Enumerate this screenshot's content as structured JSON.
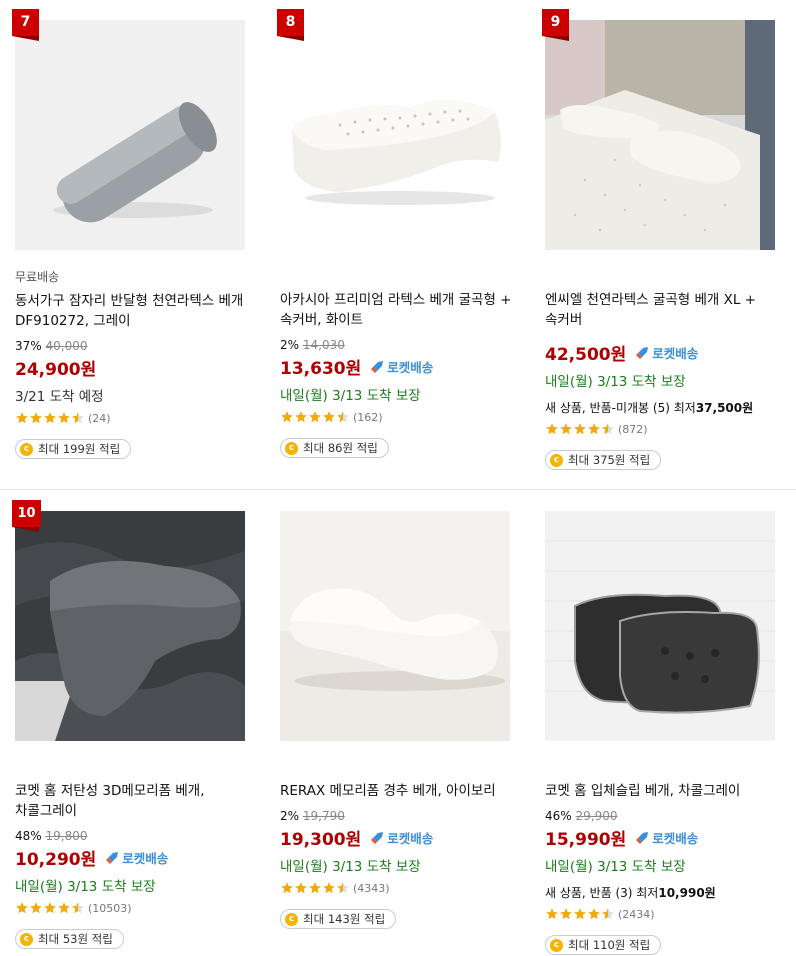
{
  "products": [
    {
      "rank": "7",
      "free_shipping": "무료배송",
      "title": "동서가구 잠자리 반달형 천연라텍스 베개 DF910272, 그레이",
      "discount_rate": "37%",
      "original_price": "40,000",
      "price": "24,900원",
      "delivery": "3/21 도착 예정",
      "rating": 4.5,
      "review_count": "(24)",
      "reward": "최대 199원 적립",
      "image": "gray-half-moon-pillow"
    },
    {
      "rank": "8",
      "title": "아카시아 프리미엄 라텍스 베개 굴곡형 + 속커버, 화이트",
      "discount_rate": "2%",
      "original_price": "14,030",
      "price": "13,630원",
      "rocket_label": "로켓배송",
      "delivery": "내일(월) 3/13 도착 보장",
      "rating": 4.5,
      "review_count": "(162)",
      "reward": "최대 86원 적립",
      "image": "white-latex-contour-pillow"
    },
    {
      "rank": "9",
      "title": "엔씨엘 천연라텍스 굴곡형 베개 XL + 속커버",
      "price": "42,500원",
      "rocket_label": "로켓배송",
      "delivery": "내일(월) 3/13 도착 보장",
      "extra_text": "새 상품, 반품-미개봉 (5) 최저",
      "extra_price": "37,500원",
      "rating": 4.5,
      "review_count": "(872)",
      "reward": "최대 375원 적립",
      "image": "latex-pillows-on-mattress"
    },
    {
      "rank": "10",
      "title": "코멧 홈 저탄성 3D메모리폼 베개, 차콜그레이",
      "discount_rate": "48%",
      "original_price": "19,800",
      "price": "10,290원",
      "rocket_label": "로켓배송",
      "delivery": "내일(월) 3/13 도착 보장",
      "rating": 4.5,
      "review_count": "(10503)",
      "reward": "최대 53원 적립",
      "image": "charcoal-memory-foam-pillow"
    },
    {
      "title": "RERAX 메모리폼 경추 베개, 아이보리",
      "discount_rate": "2%",
      "original_price": "19,790",
      "price": "19,300원",
      "rocket_label": "로켓배송",
      "delivery": "내일(월) 3/13 도착 보장",
      "rating": 4.5,
      "review_count": "(4343)",
      "reward": "최대 143원 적립",
      "image": "ivory-cervical-memory-pillow"
    },
    {
      "title": "코멧 홈 입체슬립 베개, 차콜그레이",
      "discount_rate": "46%",
      "original_price": "29,900",
      "price": "15,990원",
      "rocket_label": "로켓배송",
      "delivery": "내일(월) 3/13 도착 보장",
      "extra_text": "새 상품, 반품 (3) 최저",
      "extra_price": "10,990원",
      "rating": 4.5,
      "review_count": "(2434)",
      "reward": "최대 110원 적립",
      "image": "charcoal-3d-sleep-pillows"
    }
  ],
  "colors": {
    "price": "#ae0000",
    "rank_badge": "#cc0000",
    "rocket": "#3a8fd8",
    "delivery": "#1b7d1b",
    "star": "#f2a90b",
    "coin": "#f5b400"
  }
}
